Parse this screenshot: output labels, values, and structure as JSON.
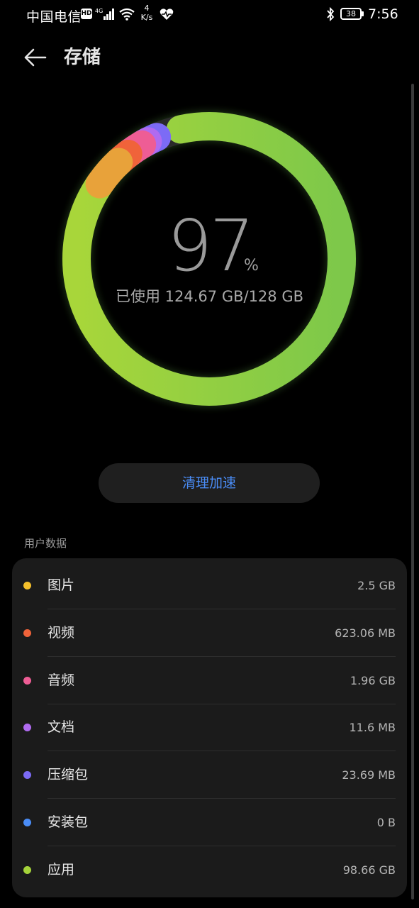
{
  "status_bar": {
    "carrier": "中国电信",
    "hd_badge": "HD",
    "network": "4G",
    "speed_value": "4",
    "speed_unit": "K/s",
    "battery": "38",
    "time": "7:56"
  },
  "header": {
    "title": "存储",
    "back_icon": "arrow-left-icon"
  },
  "storage": {
    "percent": "97",
    "percent_unit": "%",
    "usage_text": "已使用 124.67 GB/128 GB",
    "used_fraction": 0.97
  },
  "clean_button": {
    "label": "清理加速"
  },
  "section_label": "用户数据",
  "categories": [
    {
      "name": "图片",
      "value": "2.5 GB",
      "color": "#f5c02b"
    },
    {
      "name": "视频",
      "value": "623.06 MB",
      "color": "#f0633a"
    },
    {
      "name": "音频",
      "value": "1.96 GB",
      "color": "#ee5d95"
    },
    {
      "name": "文档",
      "value": "11.6 MB",
      "color": "#b06bf0"
    },
    {
      "name": "压缩包",
      "value": "23.69 MB",
      "color": "#7c6bf5"
    },
    {
      "name": "安装包",
      "value": "0 B",
      "color": "#4a8df7"
    },
    {
      "name": "应用",
      "value": "98.66 GB",
      "color": "#a5d33a"
    }
  ],
  "colors": {
    "accent": "#4a8df7",
    "ring_green": "#6cc04a",
    "ring_orange": "#e8a23a"
  }
}
